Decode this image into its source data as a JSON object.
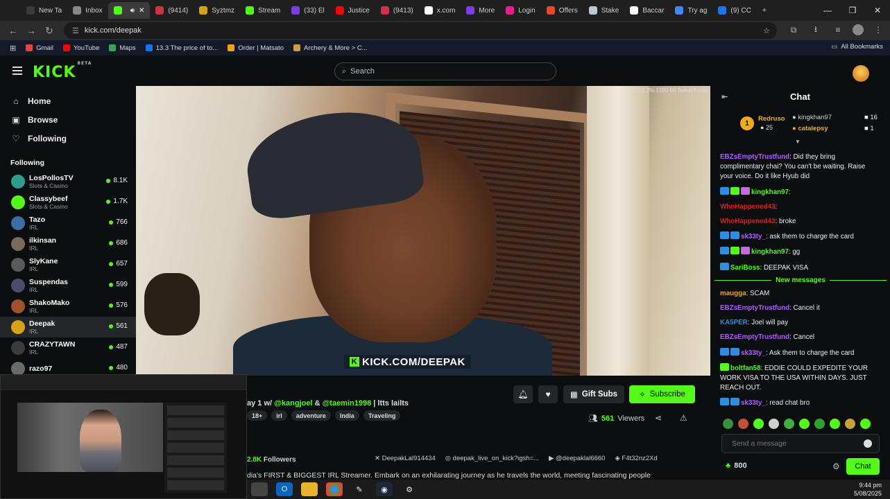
{
  "browser": {
    "tabs": [
      {
        "label": "New Ta",
        "color": "#3b3b3b"
      },
      {
        "label": "Inbox",
        "color": "#888888"
      },
      {
        "label": "",
        "color": "#53fc18",
        "active": true
      },
      {
        "label": "(9414)",
        "color": "#cc3344"
      },
      {
        "label": "Syztmz",
        "color": "#d6a21a"
      },
      {
        "label": "Stream",
        "color": "#53fc18"
      },
      {
        "label": "(33) El",
        "color": "#7b3fe4"
      },
      {
        "label": "Justice",
        "color": "#ff0000"
      },
      {
        "label": "(9413)",
        "color": "#cc3344"
      },
      {
        "label": "x.com",
        "color": "#ffffff"
      },
      {
        "label": "More",
        "color": "#7b3fe4"
      },
      {
        "label": "Login",
        "color": "#e91e8c"
      },
      {
        "label": "Offers",
        "color": "#e54b2a"
      },
      {
        "label": "Stake",
        "color": "#c0c8d0"
      },
      {
        "label": "Baccar",
        "color": "#ffffff"
      },
      {
        "label": "Try ag",
        "color": "#4285f4"
      },
      {
        "label": "(9) CC",
        "color": "#1877f2"
      }
    ],
    "new_tab": "+",
    "url": "kick.com/deepak",
    "bookmarks": [
      {
        "label": "Gmail",
        "color": "#ea4335"
      },
      {
        "label": "YouTube",
        "color": "#ff0000"
      },
      {
        "label": "Maps",
        "color": "#34a853"
      },
      {
        "label": "13.3 The price of to...",
        "color": "#1a73e8"
      },
      {
        "label": "Order | Matsato",
        "color": "#f4a11a"
      },
      {
        "label": "Archery & More > C...",
        "color": "#c8a03a"
      }
    ],
    "all_bookmarks": "All Bookmarks"
  },
  "kick": {
    "logo": "KICK",
    "beta": "BETA",
    "search_placeholder": "Search",
    "nav": [
      {
        "label": "Home",
        "icon": "home-icon",
        "glyph": "⌂"
      },
      {
        "label": "Browse",
        "icon": "browse-icon",
        "glyph": "▣"
      },
      {
        "label": "Following",
        "icon": "heart-icon",
        "glyph": "♡"
      }
    ],
    "following_header": "Following",
    "channels": [
      {
        "name": "LosPollosTV",
        "category": "Slots & Casino",
        "viewers": "8.1K",
        "color": "#2a9d8f"
      },
      {
        "name": "Classybeef",
        "category": "Slots & Casino",
        "viewers": "1.7K",
        "color": "#53fc18"
      },
      {
        "name": "Tazo",
        "category": "IRL",
        "viewers": "766",
        "color": "#3a6ea5"
      },
      {
        "name": "ilkinsan",
        "category": "IRL",
        "viewers": "686",
        "color": "#7a6a5a"
      },
      {
        "name": "SlyKane",
        "category": "IRL",
        "viewers": "657",
        "color": "#5a5a5a"
      },
      {
        "name": "Suspendas",
        "category": "IRL",
        "viewers": "599",
        "color": "#4b4b6b"
      },
      {
        "name": "ShakoMako",
        "category": "IRL",
        "viewers": "576",
        "color": "#a0522d"
      },
      {
        "name": "Deepak",
        "category": "IRL",
        "viewers": "561",
        "color": "#d6a21a",
        "selected": true
      },
      {
        "name": "CRAZYTAWN",
        "category": "IRL",
        "viewers": "487",
        "color": "#3b3b3b"
      },
      {
        "name": "razo97",
        "category": "",
        "viewers": "480",
        "color": "#6a6a6a"
      }
    ],
    "video_overlay": "KICK.COM/DEEPAK",
    "video_corner": "1:1:1 2% 1280 60 Tweet Fonts",
    "stream": {
      "title_prefix": "ay 1 w/ ",
      "mention1": "@kangjoel",
      "amp": " & ",
      "mention2": "@taemin1998",
      "title_suffix": " | ltts lailts",
      "tags": [
        "18+",
        "irl",
        "adventure",
        "India",
        "Traveling"
      ],
      "gift_label": "Gift Subs",
      "subscribe_label": "Subscribe",
      "viewers": "561",
      "viewers_label": "Viewers",
      "followers": "2.8K",
      "followers_label": "Followers",
      "socials": [
        "DeepakLal914434",
        "deepak_live_on_kick?igsh=...",
        "@deepaklal6660",
        "F4t32nz2Xd"
      ],
      "bio": "dia's FIRST & BIGGEST IRL Streamer. Embark on an exhilarating journey as he travels the world, meeting fascinating people"
    },
    "chat": {
      "title": "Chat",
      "leaderboard": {
        "rank": "1",
        "top_user": "Redruso",
        "top_value": "25",
        "user2": "kingkhan97",
        "value2": "16",
        "user3": "catalepsy",
        "value3": "1"
      },
      "messages": [
        {
          "user": "EBZsEmptyTrustfund",
          "color": "#b35cff",
          "text": "Did they bring complimentary chai? You can't be waiting. Raise your voice. Do it like Hyub did",
          "badges": []
        },
        {
          "user": "kingkhan97",
          "color": "#53fc18",
          "text": "",
          "badges": [
            "#2e8fe0",
            "#53fc18",
            "#c26ed8"
          ]
        },
        {
          "user": "WhoHappened43",
          "color": "#e02020",
          "text": "",
          "badges": []
        },
        {
          "user": "WhoHappened43",
          "color": "#e02020",
          "text": "broke",
          "badges": []
        },
        {
          "user": "sk33ty_",
          "color": "#b35cff",
          "text": "ask them to charge the card",
          "badges": [
            "#2e8fe0",
            "#2e8fe0"
          ]
        },
        {
          "user": "kingkhan97",
          "color": "#53fc18",
          "text": "gg",
          "badges": [
            "#2e8fe0",
            "#53fc18",
            "#c26ed8"
          ]
        },
        {
          "user": "SariBoss",
          "color": "#53fc18",
          "text": "DEEPAK VISA",
          "badges": [
            "#2e8fe0"
          ]
        }
      ],
      "new_messages": "New messages",
      "messages2": [
        {
          "user": "maugga",
          "color": "#f6a91b",
          "text": "SCAM",
          "badges": []
        },
        {
          "user": "EBZsEmptyTrustfund",
          "color": "#b35cff",
          "text": "Cancel it",
          "badges": []
        },
        {
          "user": "KA5PER",
          "color": "#2e8fe0",
          "text": "Joel will pay",
          "badges": []
        },
        {
          "user": "EBZsEmptyTrustfund",
          "color": "#b35cff",
          "text": "Cancel",
          "badges": []
        },
        {
          "user": "sk33ty_",
          "color": "#b35cff",
          "text": "Ask them to charge the card",
          "badges": [
            "#2e8fe0",
            "#2e8fe0"
          ]
        },
        {
          "user": "boltfan58",
          "color": "#53fc18",
          "text": "EDDIE COULD EXPEDITE YOUR WORK VISA TO THE USA WITHIN DAYS. JUST REACH OUT.",
          "badges": [
            "#53fc18"
          ]
        },
        {
          "user": "sk33ty_",
          "color": "#b35cff",
          "text": "read chat bro",
          "badges": [
            "#2e8fe0",
            "#2e8fe0"
          ]
        }
      ],
      "input_placeholder": "Send a message",
      "points": "800",
      "chat_button": "Chat"
    }
  },
  "taskbar": {
    "time": "9:44 pm",
    "date": "5/08/2025"
  }
}
